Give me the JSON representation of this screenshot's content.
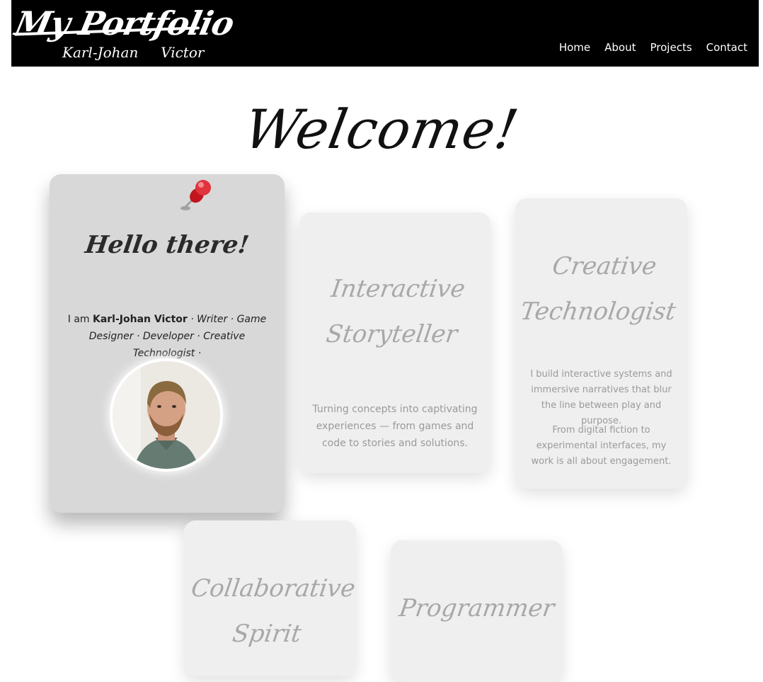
{
  "header": {
    "logo_title": "My Portfolio",
    "logo_subtitle": "Karl-Johan     Victor",
    "nav": [
      "Home",
      "About",
      "Projects",
      "Contact"
    ]
  },
  "hero": {
    "title": "Welcome!"
  },
  "intro_card": {
    "heading": "Hello there!",
    "prefix": "I am ",
    "name": "Karl-Johan Victor",
    "roles": " · Writer · Game Designer · Developer · Creative Technologist ·"
  },
  "cards": [
    {
      "title_line1": "Interactive",
      "title_line2": "Storyteller",
      "text": "Turning concepts into captivating experiences — from games and code to stories and solutions."
    },
    {
      "title_line1": "Creative",
      "title_line2": "Technologist",
      "text1": "I build interactive systems and immersive narratives that blur the line between play and purpose.",
      "text2": "From digital fiction to experimental interfaces, my work is all about engagement."
    },
    {
      "title_line1": "Collaborative",
      "title_line2": "Spirit"
    },
    {
      "title_line1": "Programmer"
    }
  ],
  "icons": {
    "pin": "pushpin-icon",
    "avatar": "profile-photo"
  },
  "colors": {
    "header_bg": "#000000",
    "intro_card_bg": "#d8d8d8",
    "card_bg": "#efefef",
    "pin_red": "#d21f2b"
  }
}
